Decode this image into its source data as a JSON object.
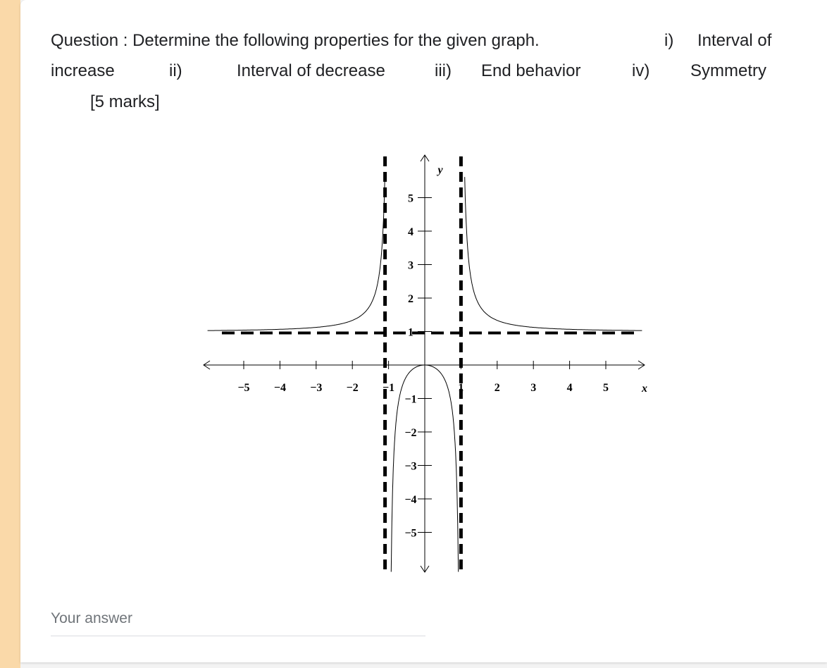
{
  "question": {
    "line1": [
      "Question : Determine the following properties for the given graph.",
      "i)",
      "Interval of"
    ],
    "line2": [
      "increase",
      "ii)",
      "Interval of decrease",
      "iii)",
      "End behavior",
      "iv)",
      "Symmetry"
    ],
    "marks": "[5 marks]"
  },
  "answer": {
    "placeholder": "Your answer"
  },
  "colors": {
    "accent_strip": "#fad9a9",
    "placeholder": "#70757a"
  },
  "chart_data": {
    "type": "line",
    "function": "y = x^2/(x^2-1)",
    "xlabel": "x",
    "ylabel": "y",
    "xlim": [
      -6,
      6
    ],
    "ylim": [
      -6,
      6
    ],
    "x_ticks": [
      "-5",
      "-4",
      "-3",
      "-2",
      "-1",
      "1",
      "2",
      "3",
      "4",
      "5"
    ],
    "y_ticks": [
      "5",
      "4",
      "3",
      "2",
      "1",
      "-1",
      "-2",
      "-3",
      "-4",
      "-5"
    ],
    "vertical_asymptotes": [
      -1,
      1
    ],
    "horizontal_asymptote": 1,
    "grid": false
  }
}
